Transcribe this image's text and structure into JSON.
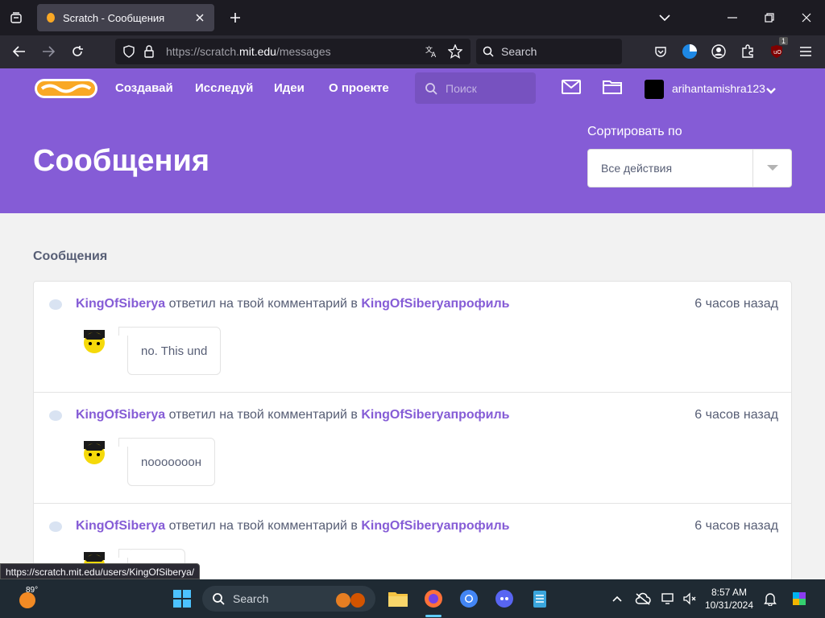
{
  "browser": {
    "tab_title": "Scratch - Сообщения",
    "url_prefix": "https://scratch.",
    "url_domain": "mit.edu",
    "url_path": "/messages",
    "search_placeholder": "Search",
    "extension_badge": "1"
  },
  "scratch_nav": {
    "create": "Создавай",
    "explore": "Исследуй",
    "ideas": "Идеи",
    "about": "О проекте",
    "search_placeholder": "Поиск",
    "username": "arihantamishra123"
  },
  "hero": {
    "title": "Сообщения",
    "sort_label": "Сортировать по",
    "sort_value": "Все действия"
  },
  "section_title": "Сообщения",
  "messages": [
    {
      "user": "KingOfSiberya",
      "action": " ответил на твой комментарий в ",
      "target": "KingOfSiberyaпрофиль",
      "time": "6 часов назад",
      "comment": "no. This und"
    },
    {
      "user": "KingOfSiberya",
      "action": " ответил на твой комментарий в ",
      "target": "KingOfSiberyaпрофиль",
      "time": "6 часов назад",
      "comment": "noooooooн"
    },
    {
      "user": "KingOfSiberya",
      "action": " ответил на твой комментарий в ",
      "target": "KingOfSiberyaпрофиль",
      "time": "6 часов назад",
      "comment": ""
    }
  ],
  "status_url": "https://scratch.mit.edu/users/KingOfSiberya/",
  "taskbar": {
    "temperature": "89°",
    "search_placeholder": "Search",
    "time": "8:57 AM",
    "date": "10/31/2024"
  },
  "colors": {
    "brand": "#855cd6",
    "link": "#855cd6"
  }
}
